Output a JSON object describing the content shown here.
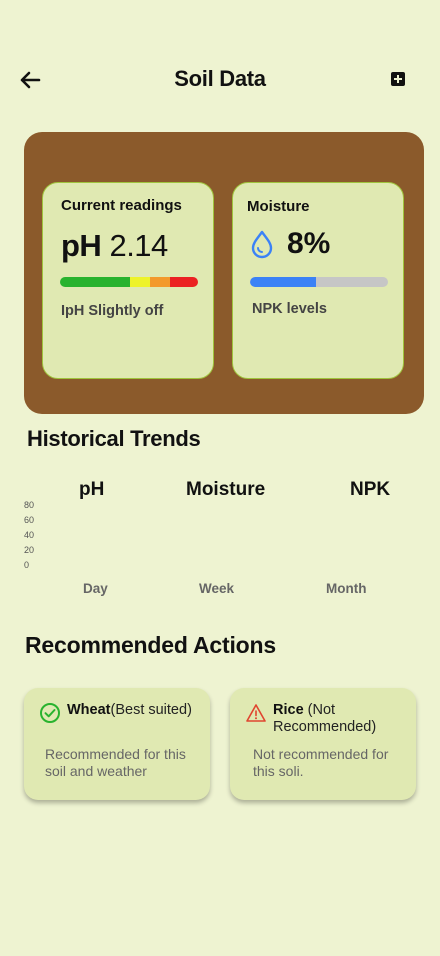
{
  "header": {
    "title": "Soil Data"
  },
  "current": {
    "title": "Current readings",
    "ph_prefix": "pH",
    "ph_value": "2.14",
    "status": "IpH Slightly off",
    "scale_colors": [
      "#29b32e",
      "#eef32a",
      "#f39a2c",
      "#eb2222"
    ]
  },
  "moisture": {
    "title": "Moisture",
    "value": "8%",
    "fill_fraction": 0.48,
    "sub": "NPK levels",
    "icon": "water-drop-icon"
  },
  "trends": {
    "title": "Historical Trends",
    "tabs": [
      "pH",
      "Moisture",
      "NPK"
    ],
    "y_ticks": [
      "80",
      "60",
      "40",
      "20",
      "0"
    ],
    "periods": [
      "Day",
      "Week",
      "Month"
    ]
  },
  "actions": {
    "title": "Recommended Actions",
    "items": [
      {
        "crop": "Wheat",
        "note": "(Best suited)",
        "desc": "Recommended for this soil and weather",
        "icon": "check-circle-icon"
      },
      {
        "crop": "Rice",
        "note": "(Not Recommended)",
        "desc": "Not recommended for this soli.",
        "icon": "warning-icon"
      }
    ]
  }
}
